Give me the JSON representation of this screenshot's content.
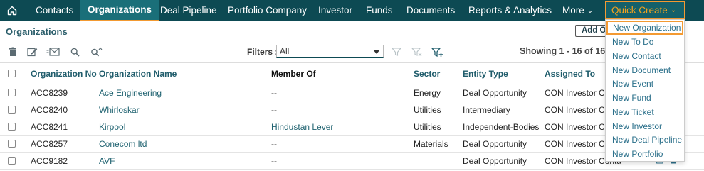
{
  "colors": {
    "nav_bg": "#0d4a53",
    "accent": "#f39a32",
    "link": "#1f6270",
    "quick_create_text": "#f5a21e"
  },
  "nav": {
    "home_icon": "home-icon",
    "items": [
      "Contacts",
      "Organizations",
      "Deal Pipeline",
      "Portfolio Company",
      "Investor",
      "Funds",
      "Documents",
      "Reports & Analytics",
      "More"
    ],
    "active": "Organizations",
    "quick_create": "Quick Create"
  },
  "page": {
    "title": "Organizations",
    "add_button": "Add Or"
  },
  "toolbar": {
    "icons": [
      "trash-icon",
      "edit-icon",
      "mail-icon",
      "search-icon",
      "advanced-search-icon"
    ],
    "filters_label": "Filters :",
    "filter_value": "All",
    "filter_icons": [
      "filter-icon",
      "clear-filter-icon",
      "add-filter-icon"
    ],
    "showing": "Showing 1 - 16 of 16"
  },
  "table": {
    "columns": [
      "Organization No",
      "Organization Name",
      "Member Of",
      "Sector",
      "Entity Type",
      "Assigned To"
    ],
    "rows": [
      {
        "no": "ACC8239",
        "name": "Ace Engineering",
        "member_of": "--",
        "sector": "Energy",
        "entity": "Deal Opportunity",
        "assigned": "CON Investor Contacts"
      },
      {
        "no": "ACC8240",
        "name": "Whirloskar",
        "member_of": "--",
        "sector": "Utilities",
        "entity": "Intermediary",
        "assigned": "CON Investor Contacts"
      },
      {
        "no": "ACC8241",
        "name": "Kirpool",
        "member_of": "Hindustan Lever",
        "sector": "Utilities",
        "entity": "Independent-Bodies",
        "assigned": "CON Investor Contacts"
      },
      {
        "no": "ACC8257",
        "name": "Conecom ltd",
        "member_of": "--",
        "sector": "Materials",
        "entity": "Deal Opportunity",
        "assigned": "CON Investor Contacts"
      },
      {
        "no": "ACC9182",
        "name": "AVF",
        "member_of": "--",
        "sector": "",
        "entity": "Deal Opportunity",
        "assigned": "CON Investor Contacts"
      }
    ]
  },
  "quick_create_menu": [
    "New Organization",
    "New To Do",
    "New Contact",
    "New Document",
    "New Event",
    "New Fund",
    "New Ticket",
    "New Investor",
    "New Deal Pipeline",
    "New Portfolio"
  ]
}
